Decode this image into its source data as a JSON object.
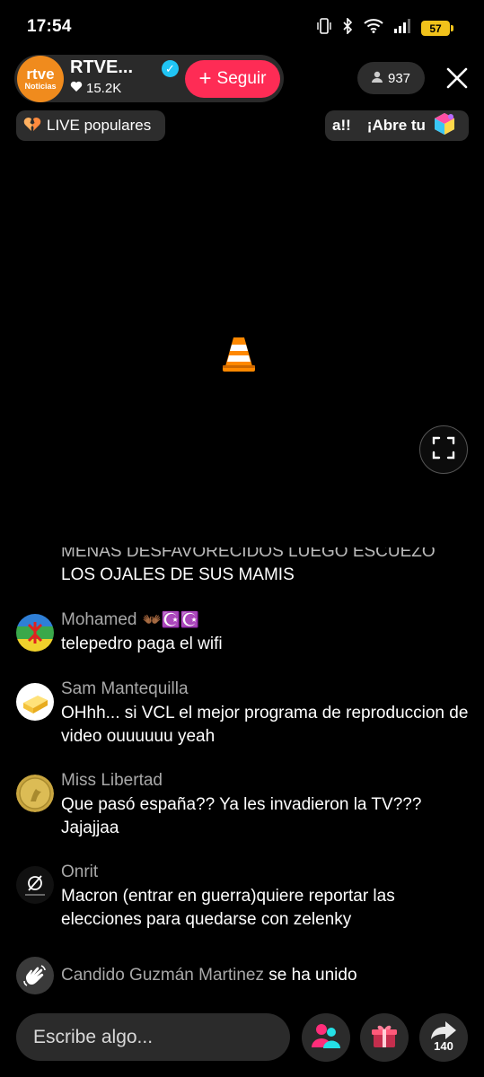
{
  "status_bar": {
    "time": "17:54",
    "battery": "57"
  },
  "host": {
    "avatar_line1": "rtve",
    "avatar_line2": "Noticias",
    "name": "RTVE...",
    "likes": "15.2K",
    "follow_label": "Seguir"
  },
  "viewers": "937",
  "live_popular": "LIVE populares",
  "promo": {
    "text_a": "a!!",
    "text_b": "¡Abre tu"
  },
  "chat": {
    "partial_line1": "MENAS DESFAVORECIDOS LUEGO ESCUEZO",
    "partial_line2": "LOS OJALES DE SUS MAMIS",
    "messages": [
      {
        "user": "Mohamed",
        "user_emoji": "👐🏾☪️☪️",
        "text": "telepedro paga el wifi",
        "avatar": "amazigh-flag"
      },
      {
        "user": "Sam Mantequilla",
        "user_emoji": "",
        "text": "OHhh... si VCL el mejor programa de reproduccion de video ouuuuuu yeah",
        "avatar": "butter"
      },
      {
        "user": "Miss Libertad",
        "user_emoji": "",
        "text": "Que pasó españa?? Ya les invadieron la TV??? Jajajjaa",
        "avatar": "coin"
      },
      {
        "user": "Onrit",
        "user_emoji": "",
        "text": "Macron (entrar en guerra)quiere reportar las elecciones para quedarse con zelenky",
        "avatar": "null-symbol"
      }
    ],
    "joined": {
      "user": "Candido Guzmán Martinez",
      "text": "se ha unido"
    }
  },
  "bottom_bar": {
    "placeholder": "Escribe algo...",
    "share_count": "140"
  },
  "colors": {
    "accent": "#fe2c55",
    "verified": "#20c5f5",
    "battery": "#f1c21b"
  },
  "icons": [
    "vibrate-icon",
    "bluetooth-icon",
    "wifi-icon",
    "signal-icon",
    "battery-icon",
    "heart-icon",
    "user-icon",
    "close-icon",
    "broken-heart-icon",
    "vlc-cone-icon",
    "fullscreen-icon",
    "wave-icon",
    "guests-icon",
    "gift-icon",
    "share-icon"
  ]
}
